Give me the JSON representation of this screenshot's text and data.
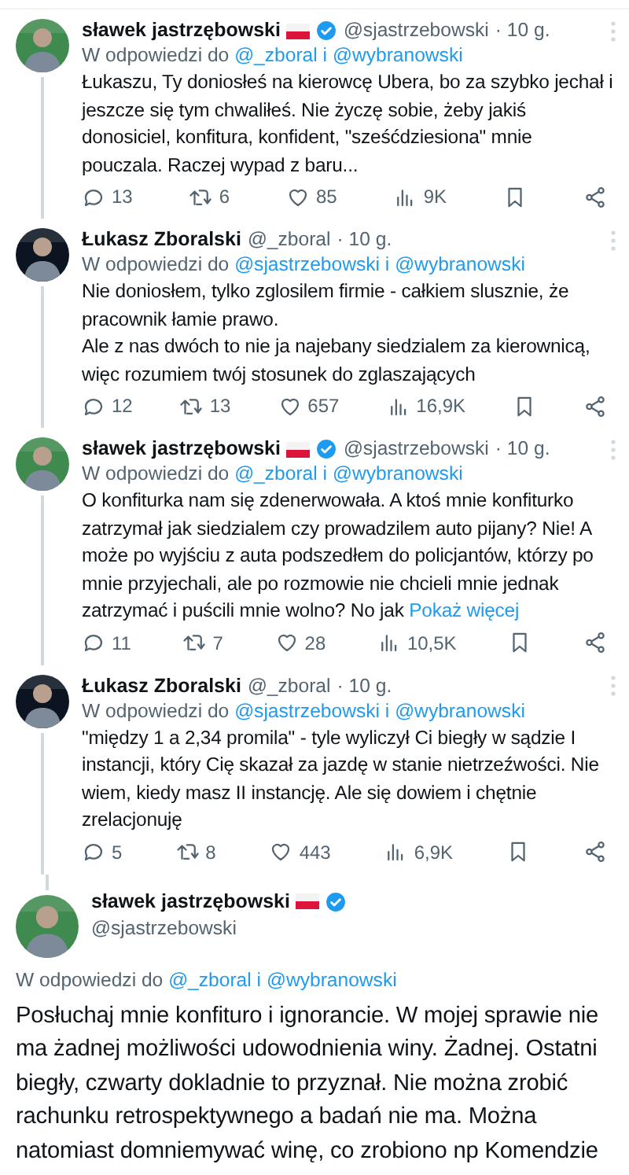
{
  "tweets": [
    {
      "kind": "reply",
      "name": "sławek jastrzębowski",
      "flag": true,
      "verified": true,
      "handle": "@sjastrzebowski",
      "time": "· 10 g.",
      "reply": {
        "prefix": "W odpowiedzi do",
        "mentions": [
          "@_zboral",
          "@wybranowski"
        ],
        "joiner": "i"
      },
      "body": "Łukaszu, Ty doniosłeś na kierowcę Ubera, bo za szybko jechał i jeszcze się tym chwaliłeś. Nie życzę sobie, żeby jakiś donosiciel, konfitura, konfident, \"sześćdziesiona\" mnie pouczala. Raczej wypad z baru...",
      "stats": {
        "replies": "13",
        "retweets": "6",
        "likes": "85",
        "views": "9K"
      }
    },
    {
      "kind": "reply",
      "name": "Łukasz Zboralski",
      "flag": false,
      "verified": false,
      "handle": "@_zboral",
      "time": "· 10 g.",
      "reply": {
        "prefix": "W odpowiedzi do",
        "mentions": [
          "@sjastrzebowski",
          "@wybranowski"
        ],
        "joiner": "i"
      },
      "body": "Nie doniosłem, tylko zglosilem firmie - całkiem slusznie, że pracownik łamie prawo.\nAle z nas dwóch to nie ja najebany siedzialem za kierownicą, więc rozumiem twój stosunek do zglaszających",
      "stats": {
        "replies": "12",
        "retweets": "13",
        "likes": "657",
        "views": "16,9K"
      }
    },
    {
      "kind": "reply",
      "name": "sławek jastrzębowski",
      "flag": true,
      "verified": true,
      "handle": "@sjastrzebowski",
      "time": "· 10 g.",
      "reply": {
        "prefix": "W odpowiedzi do",
        "mentions": [
          "@_zboral",
          "@wybranowski"
        ],
        "joiner": "i"
      },
      "body": "O konfiturka nam się zdenerwowała. A ktoś mnie konfiturko zatrzymał jak siedzialem czy prowadzilem auto pijany? Nie! A może po wyjściu z auta podszedłem do policjantów, którzy po mnie przyjechali, ale po rozmowie nie chcieli mnie jednak zatrzymać i puścili mnie wolno?  No jak",
      "more": "Pokaż więcej",
      "stats": {
        "replies": "11",
        "retweets": "7",
        "likes": "28",
        "views": "10,5K"
      }
    },
    {
      "kind": "reply",
      "name": "Łukasz Zboralski",
      "flag": false,
      "verified": false,
      "handle": "@_zboral",
      "time": "· 10 g.",
      "reply": {
        "prefix": "W odpowiedzi do",
        "mentions": [
          "@sjastrzebowski",
          "@wybranowski"
        ],
        "joiner": "i"
      },
      "body": "\"między 1 a 2,34 promila\" - tyle wyliczył Ci biegły w sądzie I instancji, który Cię skazał za jazdę w stanie nietrzeźwości. Nie wiem, kiedy masz II instancję. Ale się dowiem i chętnie zrelacjonuję",
      "stats": {
        "replies": "5",
        "retweets": "8",
        "likes": "443",
        "views": "6,9K"
      }
    },
    {
      "kind": "focus",
      "name": "sławek jastrzębowski",
      "flag": true,
      "verified": true,
      "handle": "@sjastrzebowski",
      "reply": {
        "prefix": "W odpowiedzi do",
        "mentions": [
          "@_zboral",
          "@wybranowski"
        ],
        "joiner": "i"
      },
      "body": "Posłuchaj mnie konfituro i ignorancie. W mojej sprawie nie ma żadnej możliwości udowodnienia winy. Żadnej. Ostatni biegły, czwarty dokladnie to przyznał. Nie można zrobić rachunku retrospektywnego a badań nie ma. Można natomiast domniemywać winę, co zrobiono np Komendzie"
    }
  ]
}
